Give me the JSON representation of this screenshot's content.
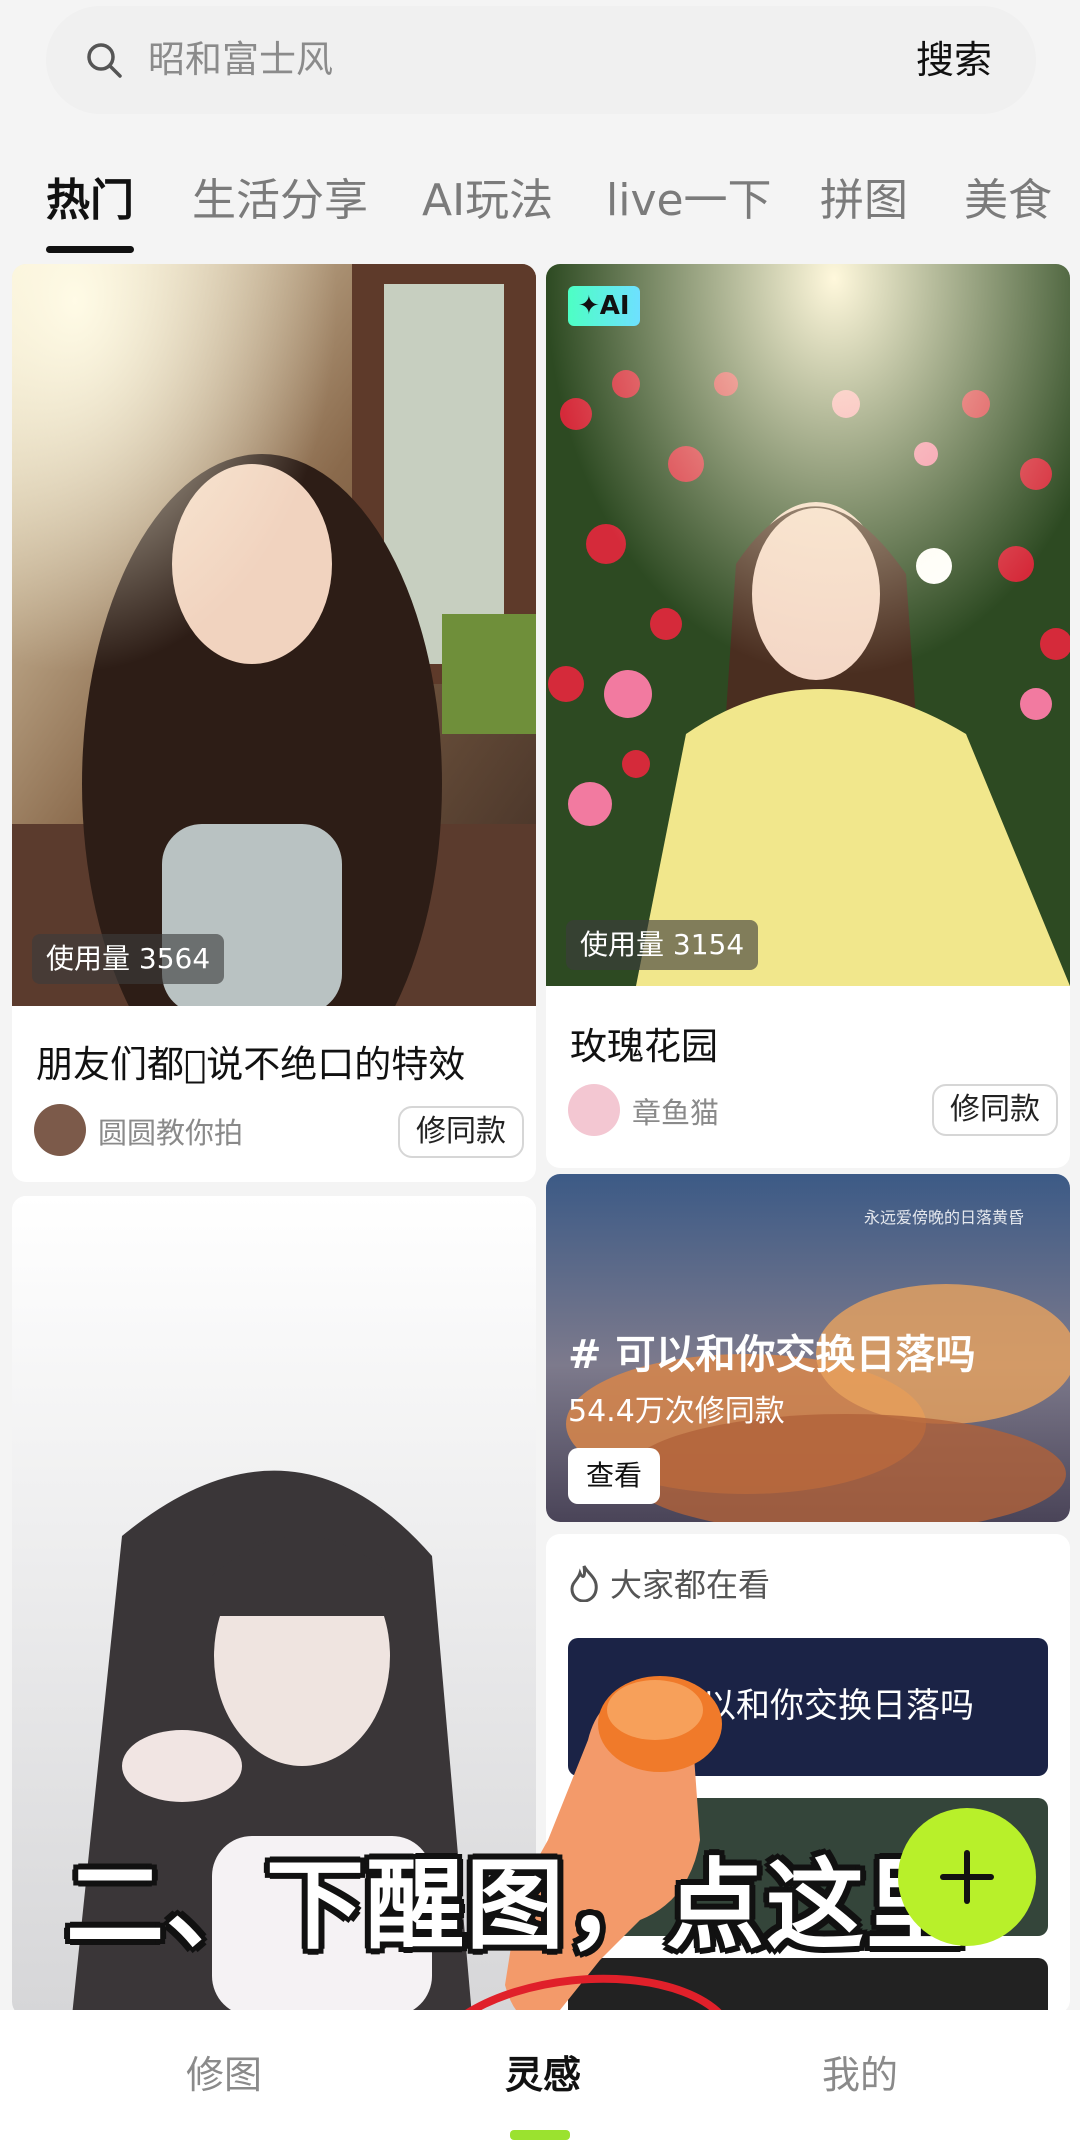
{
  "search": {
    "placeholder": "昭和富士风",
    "button_label": "搜索"
  },
  "tabs": [
    {
      "label": "热门",
      "active": true
    },
    {
      "label": "生活分享",
      "active": false
    },
    {
      "label": "AI玩法",
      "active": false
    },
    {
      "label": "live一下",
      "active": false
    },
    {
      "label": "拼图",
      "active": false
    },
    {
      "label": "美食",
      "active": false
    }
  ],
  "feed": {
    "card1": {
      "usage": "使用量 3564",
      "title": "朋友们都\u0000说不绝口的特效",
      "author": "圆圆教你拍",
      "remix_label": "修同款"
    },
    "card2": {
      "badge": "✦AI",
      "usage": "使用量 3154",
      "title": "玫瑰花园",
      "author": "章鱼猫",
      "remix_label": "修同款"
    },
    "topic": {
      "watermark": "永远爱傍晚的日落黄昏",
      "title": "# 可以和你交换日落吗",
      "count": "54.4万次修同款",
      "view_label": "查看"
    },
    "trending": {
      "header": "大家都在看",
      "items": [
        "可以和你交换日落吗"
      ]
    }
  },
  "overlay_text": "二、下醒图，点这里",
  "bottom_nav": [
    {
      "label": "修图",
      "active": false
    },
    {
      "label": "灵感",
      "active": true
    },
    {
      "label": "我的",
      "active": false
    }
  ],
  "colors": {
    "accent_green": "#b8f02a",
    "annotation_red": "#e0202a"
  }
}
